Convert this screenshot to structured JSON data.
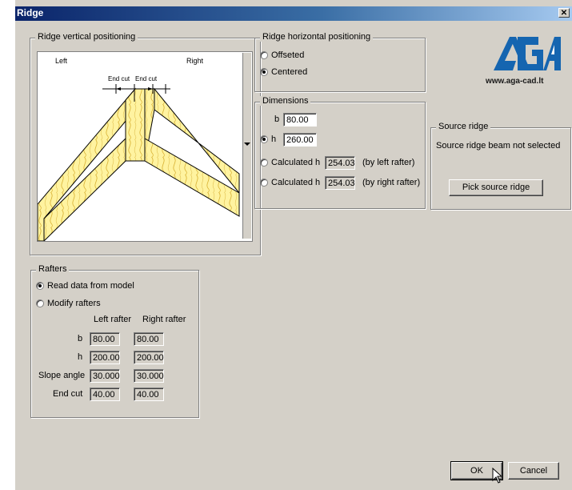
{
  "window": {
    "title": "Ridge",
    "close_glyph": "✕"
  },
  "vertical": {
    "legend": "Ridge vertical positioning",
    "left_label": "Left",
    "right_label": "Right",
    "end_cut_left": "End cut",
    "end_cut_right": "End cut"
  },
  "horizontal": {
    "legend": "Ridge horizontal positioning",
    "offseted": "Offseted",
    "centered": "Centered",
    "selected": "Centered"
  },
  "dimensions": {
    "legend": "Dimensions",
    "b_label": "b",
    "b_value": "80.00",
    "h_label": "h",
    "h_value": "260.00",
    "calc_left_label": "Calculated h",
    "calc_left_value": "254.03",
    "calc_left_note": "(by left rafter)",
    "calc_right_label": "Calculated h",
    "calc_right_value": "254.03",
    "calc_right_note": "(by right rafter)"
  },
  "logo": {
    "brand": "AGA",
    "url": "www.aga-cad.lt",
    "color": "#1565b0"
  },
  "source_ridge": {
    "legend": "Source ridge",
    "status": "Source ridge beam not selected",
    "pick_button": "Pick source ridge"
  },
  "rafters": {
    "legend": "Rafters",
    "read_data": "Read data from model",
    "modify": "Modify rafters",
    "selected": "Read data from model",
    "col_left": "Left rafter",
    "col_right": "Right rafter",
    "rows": [
      {
        "label": "b",
        "left": "80.00",
        "right": "80.00"
      },
      {
        "label": "h",
        "left": "200.00",
        "right": "200.00"
      },
      {
        "label": "Slope angle",
        "left": "30.000",
        "right": "30.000"
      },
      {
        "label": "End cut",
        "left": "40.00",
        "right": "40.00"
      }
    ]
  },
  "buttons": {
    "ok": "OK",
    "cancel": "Cancel"
  }
}
